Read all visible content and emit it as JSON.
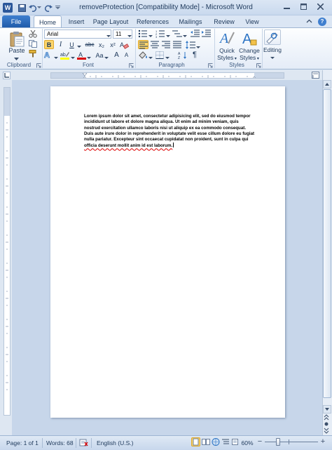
{
  "window": {
    "title": "removeProtection [Compatibility Mode] - Microsoft Word"
  },
  "tabs": [
    "File",
    "Home",
    "Insert",
    "Page Layout",
    "References",
    "Mailings",
    "Review",
    "View"
  ],
  "ribbon": {
    "clipboard": {
      "paste_label": "Paste",
      "group_label": "Clipboard"
    },
    "font": {
      "font_name": "Arial",
      "font_size": "11",
      "group_label": "Font",
      "bold": "B",
      "italic": "I",
      "underline": "U",
      "strike": "abc",
      "subscript": "x₂",
      "superscript": "x²",
      "grow": "A",
      "shrink": "A",
      "case": "Aa"
    },
    "paragraph": {
      "group_label": "Paragraph"
    },
    "styles": {
      "quick_styles_line1": "Quick",
      "quick_styles_line2": "Styles",
      "change_styles_line1": "Change",
      "change_styles_line2": "Styles",
      "group_label": "Styles"
    },
    "editing": {
      "label": "Editing"
    }
  },
  "document": {
    "text_plain": "Lorem ipsum dolor sit amet, consectetur adipisicing elit, sed do eiusmod tempor incididunt ut labore et dolore magna aliqua. Ut enim ad minim veniam, quis nostrud exercitation ullamco laboris nisi ut aliquip ex ea commodo consequat. Duis aute irure dolor in reprehenderit in voluptate velit esse cillum dolore eu fugiat nulla pariatur. Excepteur sint occaecat cupidatat non proident, sunt in culpa qui ",
    "text_marked": "officia deserunt mollit anim id est laborum."
  },
  "status": {
    "page": "Page: 1 of 1",
    "words": "Words: 68",
    "language": "English (U.S.)",
    "zoom": "60%"
  },
  "colors": {
    "accent": "#2b579a",
    "file_tab": "#1e5aa8",
    "selected": "#fbd56c"
  }
}
